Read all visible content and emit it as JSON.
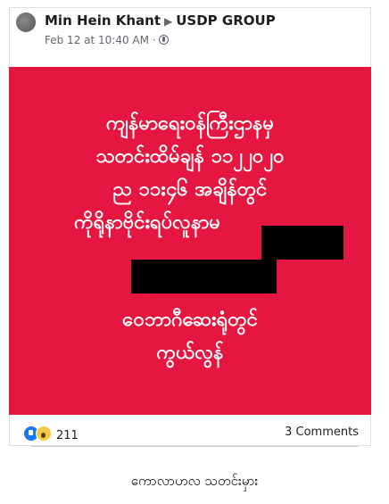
{
  "post": {
    "author": "Min Hein Khant",
    "group": "USDP GROUP",
    "timestamp": "Feb 12 at 10:40 AM",
    "separator": "·",
    "privacy_icon": "globe-icon"
  },
  "image": {
    "background_color": "#e5163f",
    "lines": [
      "ကျန်မာရေး၀န်ကြီးဌာနမှ",
      "သတင်းထိမ်ချန် ၁၁၂၂၀၂၀",
      "ည ၁၁း၄၆ အချိန်တွင်",
      "ကိုရိုနာဗိုင်းရပ်လူနာမ",
      "၀ေဘာဂီဆေးရုံတွင်",
      "ကွယ်လွန်"
    ]
  },
  "footer": {
    "reaction_icons": [
      "like-icon",
      "wow-icon"
    ],
    "reaction_count": "211",
    "comments": "3 Comments"
  },
  "caption": "ကောလာဟလ သတင်းမှား"
}
